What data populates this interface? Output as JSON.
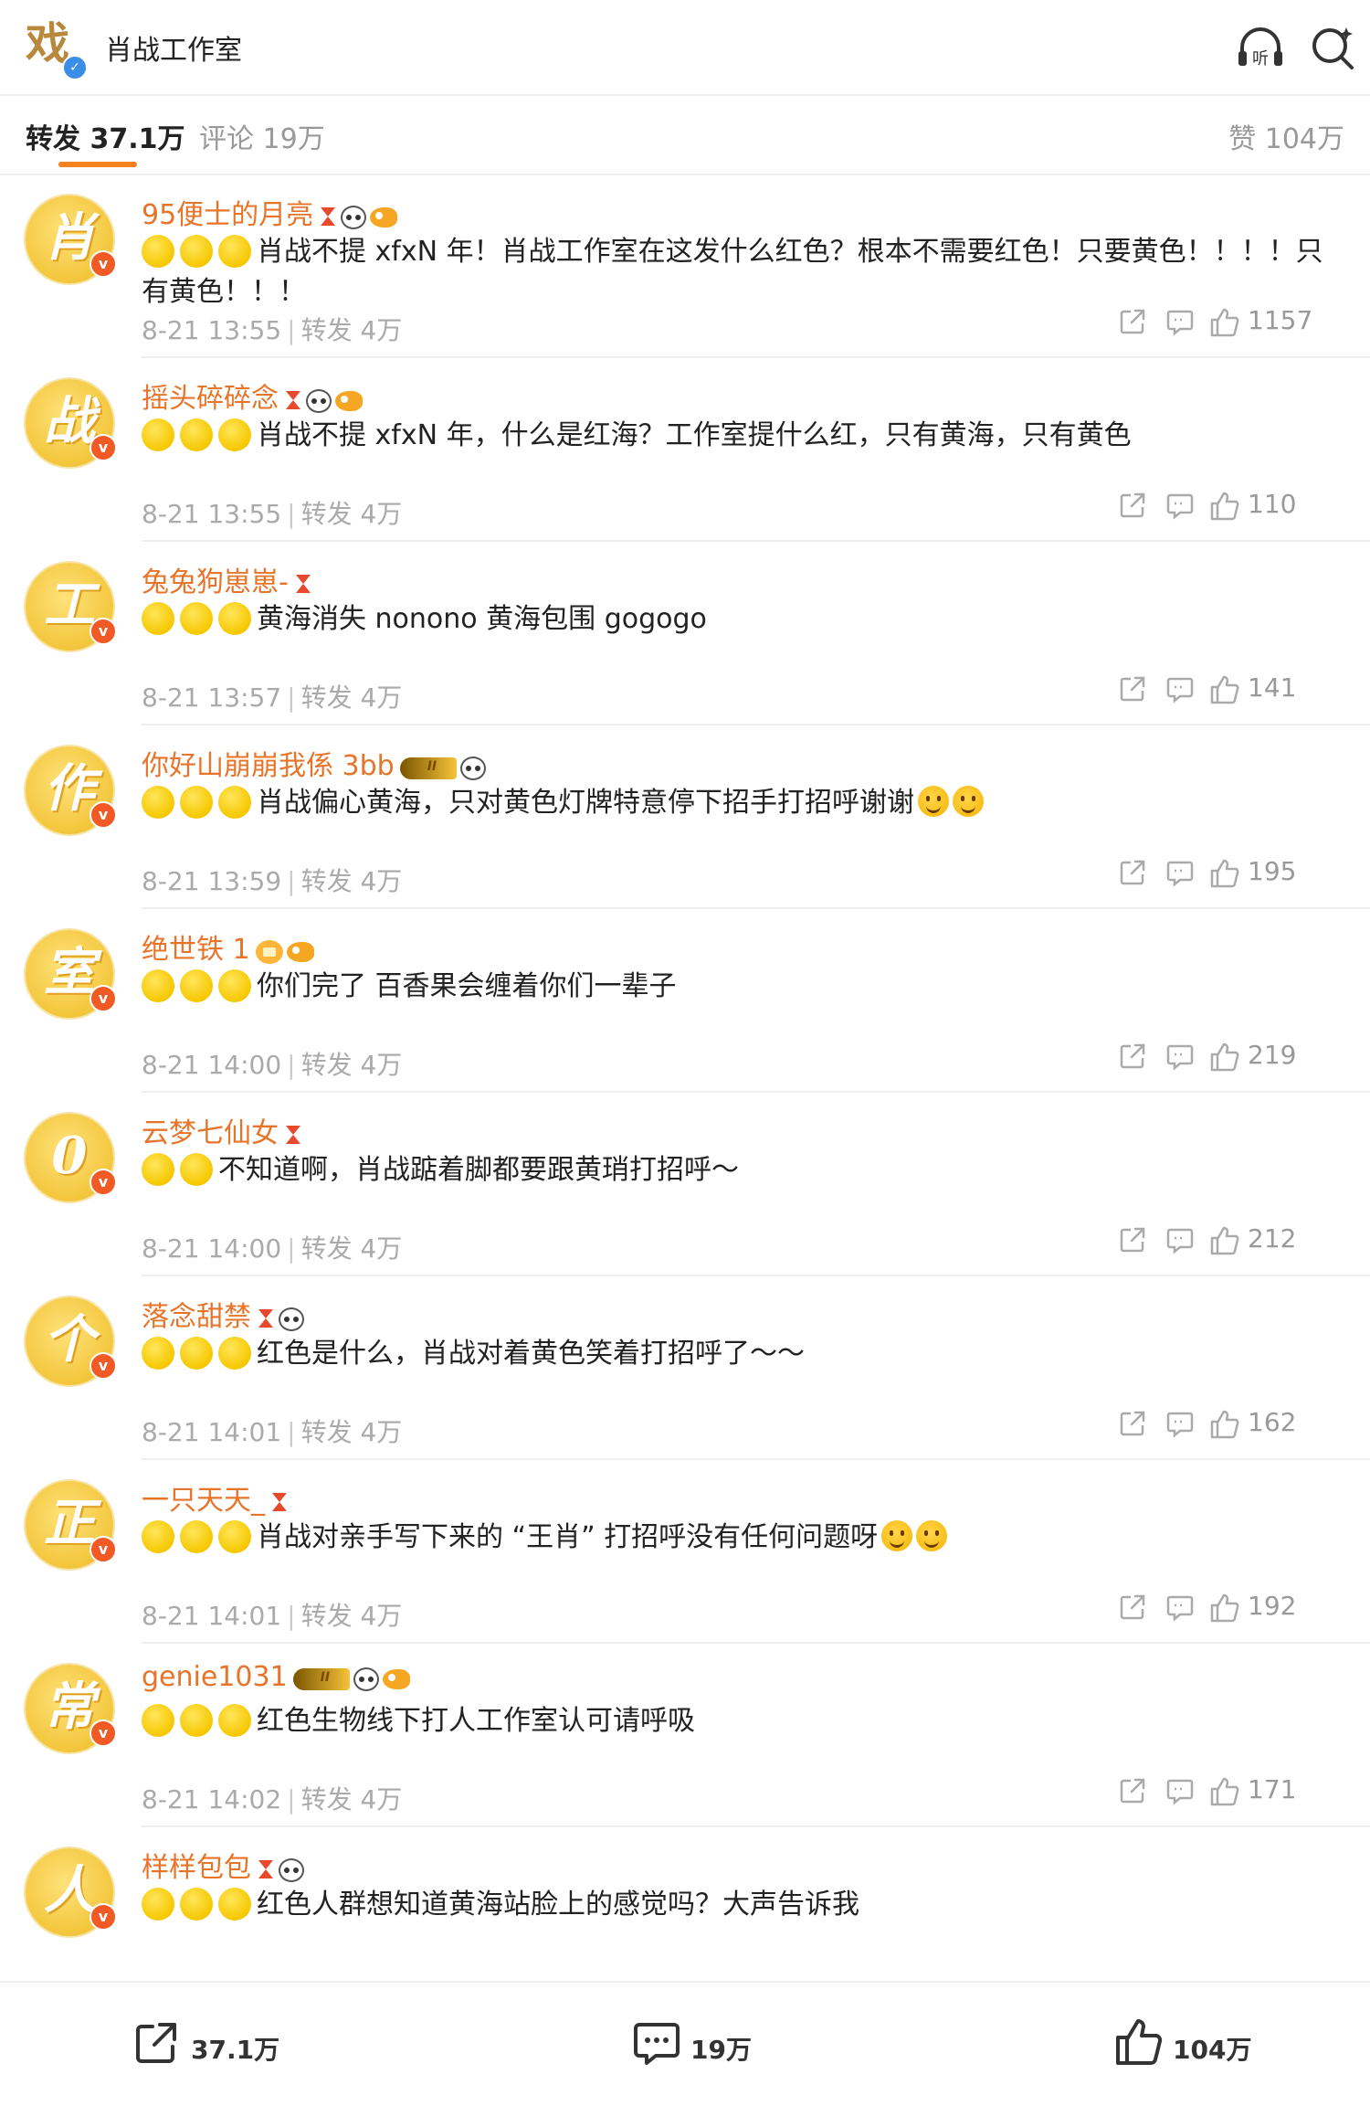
{
  "header": {
    "logo_glyph": "戏",
    "title": "肖战工作室",
    "icons": [
      "listen-icon",
      "search-icon"
    ],
    "listen_label": "听"
  },
  "tabs": {
    "repost": "转发 37.1万",
    "comments": "评论 19万",
    "likes": "赞 104万"
  },
  "comments": [
    {
      "avatar_char": "肖",
      "username": "95便士的月亮",
      "badges": [
        "hourglass",
        "panda",
        "fish"
      ],
      "dots": 3,
      "text": "肖战不提 xfxN 年！肖战工作室在这发什么红色？根本不需要红色！只要黄色！！！！只有黄色！！！",
      "emojis": 0,
      "time": "8-21 13:55",
      "repost": "转发 4万",
      "likes": "1157"
    },
    {
      "avatar_char": "战",
      "username": "摇头碎碎念",
      "badges": [
        "hourglass",
        "panda",
        "fish"
      ],
      "dots": 3,
      "text": "肖战不提 xfxN 年，什么是红海？工作室提什么红，只有黄海，只有黄色",
      "emojis": 0,
      "time": "8-21 13:55",
      "repost": "转发 4万",
      "likes": "110"
    },
    {
      "avatar_char": "工",
      "username": "兔兔狗崽崽-",
      "badges": [
        "hourglass"
      ],
      "dots": 3,
      "text": "黄海消失 nonono 黄海包围 gogogo",
      "emojis": 0,
      "time": "8-21 13:57",
      "repost": "转发 4万",
      "likes": "141"
    },
    {
      "avatar_char": "作",
      "username": "你好山崩崩我係 3bb",
      "badges": [
        "crown",
        "panda"
      ],
      "dots": 3,
      "text": "肖战偏心黄海，只对黄色灯牌特意停下招手打招呼谢谢",
      "emojis": 2,
      "time": "8-21 13:59",
      "repost": "转发 4万",
      "likes": "195"
    },
    {
      "avatar_char": "室",
      "username": "绝世铁 1",
      "badges": [
        "crown2",
        "fish"
      ],
      "dots": 3,
      "text": "你们完了 百香果会缠着你们一辈子",
      "emojis": 0,
      "time": "8-21 14:00",
      "repost": "转发 4万",
      "likes": "219"
    },
    {
      "avatar_char": "0",
      "username": "云梦七仙女",
      "badges": [
        "hourglass"
      ],
      "dots": 2,
      "text": "不知道啊，肖战踮着脚都要跟黄琑打招呼～",
      "emojis": 0,
      "time": "8-21 14:00",
      "repost": "转发 4万",
      "likes": "212"
    },
    {
      "avatar_char": "个",
      "username": "落念甜禁",
      "badges": [
        "hourglass",
        "panda"
      ],
      "dots": 3,
      "text": "红色是什么，肖战对着黄色笑着打招呼了～～",
      "emojis": 0,
      "time": "8-21 14:01",
      "repost": "转发 4万",
      "likes": "162"
    },
    {
      "avatar_char": "正",
      "username": "一只天天_",
      "badges": [
        "hourglass"
      ],
      "dots": 3,
      "text": "肖战对亲手写下来的 “王肖” 打招呼没有任何问题呀",
      "emojis": 2,
      "time": "8-21 14:01",
      "repost": "转发 4万",
      "likes": "192"
    },
    {
      "avatar_char": "常",
      "username": "genie1031",
      "badges": [
        "crown",
        "panda",
        "fish"
      ],
      "dots": 3,
      "text": "红色生物线下打人工作室认可请呼吸",
      "emojis": 0,
      "time": "8-21 14:02",
      "repost": "转发 4万",
      "likes": "171"
    },
    {
      "avatar_char": "人",
      "username": "样样包包",
      "badges": [
        "hourglass",
        "panda"
      ],
      "dots": 3,
      "text": "红色人群想知道黄海站脸上的感觉吗？大声告诉我",
      "emojis": 0,
      "time": "",
      "repost": "",
      "likes": ""
    }
  ],
  "bottom_bar": {
    "repost": "37.1万",
    "comment": "19万",
    "like": "104万"
  },
  "colors": {
    "username": "#e8742a",
    "tab_underline": "#f58220",
    "avatar_bg": "#f3c63c",
    "verified_blue": "#3a8ee6"
  }
}
